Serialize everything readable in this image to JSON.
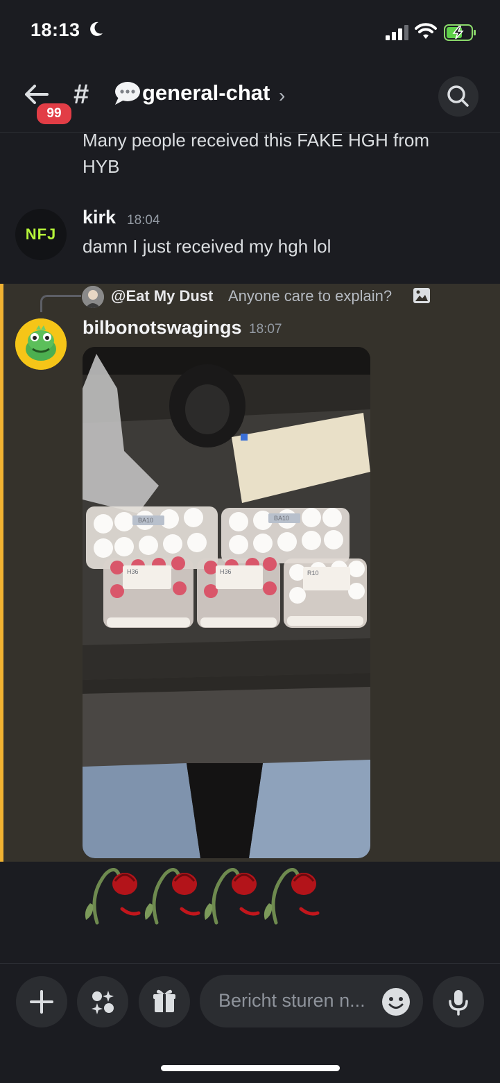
{
  "status_bar": {
    "time": "18:13"
  },
  "header": {
    "badge": "99",
    "hash": "#",
    "channel_name": "general-chat",
    "chevron": "›"
  },
  "messages": [
    {
      "text": "Many people received this FAKE HGH from HYB"
    },
    {
      "avatar_text": "NFJ",
      "username": "kirk",
      "time": "18:04",
      "text": "damn I just received my hgh lol"
    },
    {
      "reply": {
        "user": "@Eat My Dust",
        "text": "Anyone care to explain?"
      },
      "username": "bilbonotswagings",
      "time": "18:07",
      "photo_labels": [
        "BA10",
        "BA10",
        "H36",
        "H36",
        "R10"
      ]
    }
  ],
  "composer": {
    "placeholder": "Bericht sturen n..."
  },
  "colors": {
    "mention_bar": "#f0b232",
    "mention_bg": "#35322b",
    "badge": "#e23d46",
    "nfj_text": "#b5f43a"
  },
  "icons": [
    "back-arrow-icon",
    "search-icon",
    "plus-icon",
    "apps-icon",
    "gift-icon",
    "emoji-icon",
    "mic-icon",
    "image-icon",
    "speech-bubble-icon",
    "rose-emoji"
  ]
}
